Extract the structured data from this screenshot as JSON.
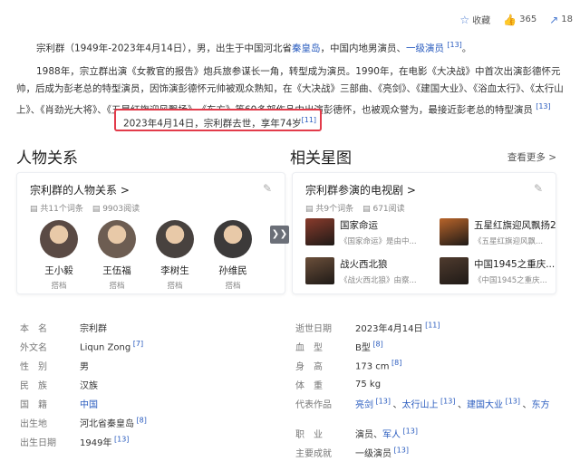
{
  "top_actions": {
    "collect": "收藏",
    "likes": "365",
    "shares": "18"
  },
  "intro": {
    "p1": [
      {
        "t": "宗利群（1949年-2023年4月14日），男，出生于中国河北省"
      },
      {
        "t": "秦皇岛",
        "link": true
      },
      {
        "t": "，中国内地男演员、"
      },
      {
        "t": "一级演员",
        "link": true
      },
      {
        "t": " "
      },
      {
        "t": "[13]",
        "ref": true
      },
      {
        "t": "。"
      }
    ],
    "p2": [
      {
        "t": "1988年，宗立群出演《女教官的报告》炮兵旅参谋长一角，转型成为演员。1990年，在电影《大决战》中首次出演彭德怀元帅，后成为彭老总的特型演员，因饰演彭德怀元帅被观众熟知，在《大决战》三部曲、《亮剑》、《建国大业》、《浴血太行》、《太行山上》、《肖劲光大将》、《五星红旗迎风飘扬》、《东方》等60多部作品中出演彭德怀，也被观众誉为，最接近彭老总的特型演员 "
      },
      {
        "t": "[13]",
        "ref": true
      }
    ],
    "highlight": "2023年4月14日，宗利群去世，享年74岁",
    "highlight_ref": "[11]"
  },
  "relations": {
    "section_title": "人物关系",
    "card_title": "宗利群的人物关系",
    "card_title_chevron": ">",
    "count": "共11个词条",
    "views": "9903阅读",
    "people": [
      {
        "name": "王小毅",
        "role": "搭档",
        "color": "#5a4a44"
      },
      {
        "name": "王伍福",
        "role": "搭档",
        "color": "#6d5d52"
      },
      {
        "name": "李树生",
        "role": "搭档",
        "color": "#48423f"
      },
      {
        "name": "孙维民",
        "role": "搭档",
        "color": "#3c3a3a"
      }
    ]
  },
  "related": {
    "section_title": "相关星图",
    "more": "查看更多",
    "more_chevron": ">",
    "card_title": "宗利群参演的电视剧",
    "card_title_chevron": ">",
    "count": "共9个词条",
    "views": "671阅读",
    "shows": [
      {
        "title": "国家命运",
        "sub": "《国家命运》是由中...",
        "color": "#8a3b2c"
      },
      {
        "title": "五星红旗迎风飘扬2",
        "sub": "《五星红旗迎风飘...",
        "color": "#b8642a"
      },
      {
        "title": "战火西北狼",
        "sub": "《战火西北狼》由察...",
        "color": "#6b4f3a"
      },
      {
        "title": "中国1945之重庆...",
        "sub": "《中国1945之重庆...",
        "color": "#4f3b2e"
      }
    ]
  },
  "info_left": [
    {
      "label": "本　名",
      "value": "宗利群"
    },
    {
      "label": "外文名",
      "value": "Liqun Zong",
      "ref": "[7]"
    },
    {
      "label": "性　别",
      "value": "男"
    },
    {
      "label": "民　族",
      "value": "汉族"
    },
    {
      "label": "国　籍",
      "value": "中国",
      "link": true
    },
    {
      "label": "出生地",
      "value": "河北省秦皇岛",
      "ref": "[8]"
    },
    {
      "label": "出生日期",
      "value": "1949年",
      "ref": "[13]"
    }
  ],
  "info_right": [
    {
      "label": "逝世日期",
      "value": "2023年4月14日",
      "ref": "[11]"
    },
    {
      "label": "血　型",
      "value": "B型",
      "ref": "[8]"
    },
    {
      "label": "身　高",
      "value": "173 cm",
      "ref": "[8]"
    },
    {
      "label": "体　重",
      "value": "75 kg"
    },
    {
      "label": "代表作品",
      "works": [
        {
          "t": "亮剑",
          "ref": "[13]"
        },
        {
          "t": "太行山上",
          "ref": "[13]"
        },
        {
          "t": "建国大业",
          "ref": "[13]"
        },
        {
          "t": "东方"
        }
      ]
    },
    {
      "label": "职　业",
      "value": "演员、",
      "value_link": "军人",
      "ref": "[13]"
    },
    {
      "label": "主要成就",
      "value": "一级演员",
      "ref": "[13]"
    }
  ]
}
